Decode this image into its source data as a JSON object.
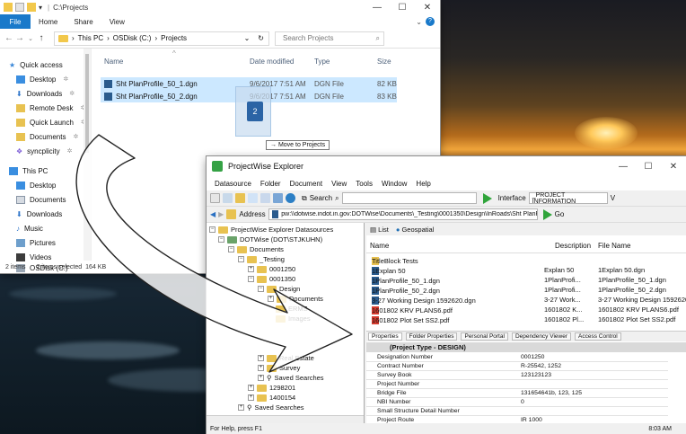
{
  "explorer": {
    "title": "C:\\Projects",
    "tabs": [
      "File",
      "Home",
      "Share",
      "View"
    ],
    "breadcrumb": [
      "This PC",
      "OSDisk (C:)",
      "Projects"
    ],
    "search_placeholder": "Search Projects",
    "nav_items": [
      {
        "label": "Quick access",
        "icon": "star-icon"
      },
      {
        "label": "Desktop",
        "icon": "desktop-icon",
        "pinned": true
      },
      {
        "label": "Downloads",
        "icon": "download-icon",
        "pinned": true
      },
      {
        "label": "Remote Desk",
        "icon": "folder-icon",
        "pinned": true
      },
      {
        "label": "Quick Launch",
        "icon": "folder-icon",
        "pinned": true
      },
      {
        "label": "Documents",
        "icon": "folder-icon",
        "pinned": true
      },
      {
        "label": "syncplicity",
        "icon": "sync-icon",
        "pinned": true
      },
      {
        "label": "This PC",
        "icon": "pc-icon"
      },
      {
        "label": "Desktop",
        "icon": "desktop-icon"
      },
      {
        "label": "Documents",
        "icon": "documents-icon"
      },
      {
        "label": "Downloads",
        "icon": "download-icon"
      },
      {
        "label": "Music",
        "icon": "music-icon"
      },
      {
        "label": "Pictures",
        "icon": "pictures-icon"
      },
      {
        "label": "Videos",
        "icon": "videos-icon"
      },
      {
        "label": "OSDisk (C:)",
        "icon": "disk-icon"
      }
    ],
    "pin_glyph": "✲",
    "columns": [
      "Name",
      "Date modified",
      "Type",
      "Size"
    ],
    "files": [
      {
        "name": "Sht PlanProfile_50_1.dgn",
        "modified": "9/6/2017 7:51 AM",
        "type": "DGN File",
        "size": "82 KB"
      },
      {
        "name": "Sht PlanProfile_50_2.dgn",
        "modified": "9/6/2017 7:51 AM",
        "type": "DGN File",
        "size": "83 KB"
      }
    ],
    "drag_tip": "→ Move to Projects",
    "status_items": "2 items",
    "status_selected": "2 items selected",
    "status_size": "164 KB"
  },
  "pw": {
    "title": "ProjectWise Explorer",
    "menu": [
      "Datasource",
      "Folder",
      "Document",
      "View",
      "Tools",
      "Window",
      "Help"
    ],
    "search_label": "Search",
    "interface_label": "Interface",
    "interface_value": "_PROJECT INFORMATION",
    "interface_value_trail": "V",
    "address_label": "Address",
    "address_value": "pw:\\\\dotwise.indot.in.gov:DOTWise\\Documents\\_Testing\\0001350\\Design\\InRoads\\Sht PlanProfile_50_1.dgn",
    "go_label": "Go",
    "tree": [
      {
        "label": "ProjectWise Explorer Datasources",
        "depth": 0,
        "exp": "−"
      },
      {
        "label": "DOTWise (DOT\\STJKUHN)",
        "depth": 1,
        "exp": "−"
      },
      {
        "label": "Documents",
        "depth": 2,
        "exp": "−"
      },
      {
        "label": "_Testing",
        "depth": 3,
        "exp": "−"
      },
      {
        "label": "0001250",
        "depth": 4,
        "exp": "+"
      },
      {
        "label": "0001350",
        "depth": 4,
        "exp": "−"
      },
      {
        "label": "Design",
        "depth": 5,
        "exp": "−"
      },
      {
        "label": "Documents",
        "depth": 6,
        "exp": "+"
      },
      {
        "label": "ERMS",
        "depth": 6,
        "exp": ""
      },
      {
        "label": "Images",
        "depth": 6,
        "exp": ""
      },
      {
        "label": "Real Estate",
        "depth": 5,
        "exp": "+"
      },
      {
        "label": "Survey",
        "depth": 5,
        "exp": "+"
      },
      {
        "label": "Saved Searches",
        "depth": 5,
        "exp": "+"
      },
      {
        "label": "1298201",
        "depth": 4,
        "exp": "+"
      },
      {
        "label": "1400154",
        "depth": 4,
        "exp": "+"
      },
      {
        "label": "Saved Searches",
        "depth": 3,
        "exp": "+"
      }
    ],
    "view_tabs": [
      "List",
      "Geospatial"
    ],
    "list_columns": [
      "Name",
      "Description",
      "File Name"
    ],
    "docs": [
      {
        "name": "TitleBlock Tests",
        "desc": "",
        "file": "",
        "icon": "folder"
      },
      {
        "name": "1Explan 50",
        "desc": "Explan 50",
        "file": "1Explan 50.dgn",
        "icon": "dgn"
      },
      {
        "name": "1PlanProfile_50_1.dgn",
        "desc": "1PlanProfi...",
        "file": "1PlanProfile_50_1.dgn",
        "icon": "dgn"
      },
      {
        "name": "1PlanProfile_50_2.dgn",
        "desc": "1PlanProfi...",
        "file": "1PlanProfile_50_2.dgn",
        "icon": "dgn"
      },
      {
        "name": "3-27 Working Design 1592620.dgn",
        "desc": "3-27 Work...",
        "file": "3-27 Working Design 1592620.d",
        "icon": "dgn"
      },
      {
        "name": "1601802 KRV PLANS6.pdf",
        "desc": "1601802 K...",
        "file": "1601802 KRV PLANS6.pdf",
        "icon": "pdf"
      },
      {
        "name": "1601802 Plot Set SS2.pdf",
        "desc": "1601802 Pl...",
        "file": "1601802 Plot Set SS2.pdf",
        "icon": "pdf"
      }
    ],
    "prop_tabs": [
      "Properties",
      "Folder Properties",
      "Personal Portal",
      "Dependency Viewer",
      "Access Control"
    ],
    "prop_title": "(Project Type - DESIGN)",
    "props": [
      {
        "k": "Designation Number",
        "v": "0001250"
      },
      {
        "k": "Contract Number",
        "v": "R-25542, 1252"
      },
      {
        "k": "Survey Book",
        "v": "123123123"
      },
      {
        "k": "Project Number",
        "v": ""
      },
      {
        "k": "Bridge File",
        "v": "131654641b, 123, 125"
      },
      {
        "k": "NBI Number",
        "v": "0"
      },
      {
        "k": "Small Structure Detail Number",
        "v": ""
      },
      {
        "k": "Project Route",
        "v": "IR 1000"
      }
    ],
    "status_help": "For Help, press F1",
    "status_time": "8:03 AM"
  },
  "colors": {
    "accent": "#1979ca",
    "selection": "#cce8ff",
    "pw_green": "#35a245"
  }
}
